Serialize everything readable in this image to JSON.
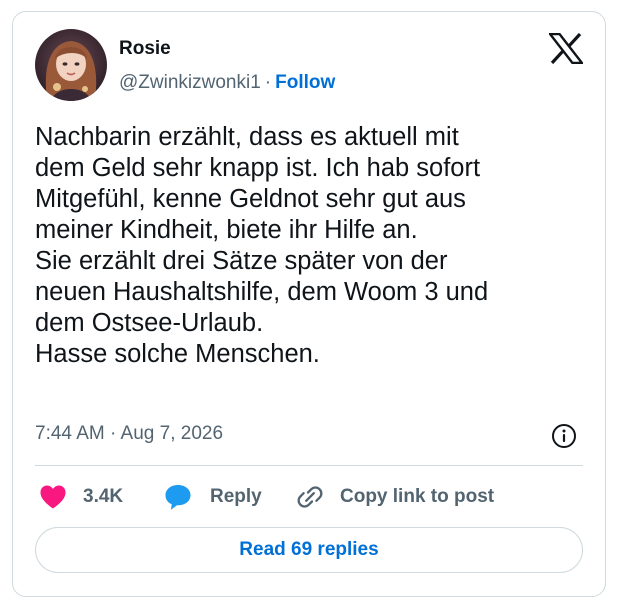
{
  "author": {
    "name": "Rosie",
    "handle": "@Zwinkizwonki1",
    "separator": "·",
    "follow_label": "Follow"
  },
  "tweet": {
    "lines": [
      "Nachbarin erzählt, dass es aktuell mit",
      "dem Geld sehr knapp ist. Ich hab sofort",
      "Mitgefühl, kenne Geldnot sehr gut aus",
      "meiner Kindheit, biete ihr Hilfe an.",
      "Sie erzählt drei Sätze später von der",
      "neuen Haushaltshilfe, dem Woom 3 und",
      "dem Ostsee-Urlaub.",
      "Hasse solche Menschen."
    ],
    "timestamp": "7:44 AM · Aug 7, 2026"
  },
  "actions": {
    "like_count": "3.4K",
    "reply_label": "Reply",
    "copy_link_label": "Copy link to post"
  },
  "read_replies_label": "Read 69 replies",
  "icons": {
    "logo": "x-logo-icon",
    "info": "info-icon",
    "like": "heart-icon",
    "reply": "speech-bubble-icon",
    "copy": "link-icon"
  },
  "colors": {
    "text": "#0f1419",
    "secondary": "#536471",
    "link": "#006fd6",
    "like": "#f91880",
    "reply": "#1d9bf0",
    "border": "#cfd9de"
  }
}
